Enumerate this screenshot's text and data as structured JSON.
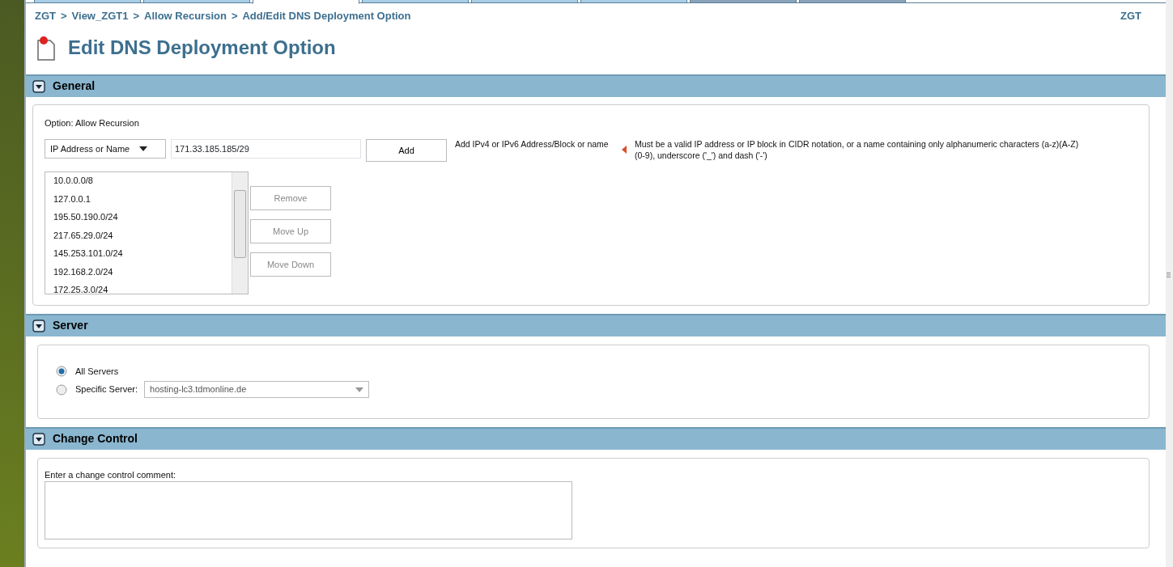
{
  "top_tabs": [
    {
      "selected": false,
      "color": "#a9cfe8"
    },
    {
      "selected": false,
      "color": "#a9cfe8"
    },
    {
      "selected": true,
      "color": "#ffffff"
    },
    {
      "selected": false,
      "color": "#a9cfe8"
    },
    {
      "selected": false,
      "color": "#a9cfe8"
    },
    {
      "selected": false,
      "color": "#a9cfe8"
    },
    {
      "selected": false,
      "color": "#8aa3b8"
    },
    {
      "selected": false,
      "color": "#8aa3b8"
    }
  ],
  "breadcrumb": {
    "items": [
      "ZGT",
      "View_ZGT1",
      "Allow Recursion",
      "Add/Edit DNS Deployment Option"
    ],
    "separator": ">",
    "user": "ZGT"
  },
  "page_title": "Edit DNS Deployment Option",
  "sections": [
    {
      "kind": "general",
      "title": "General",
      "expanded": true,
      "option_label": "Option: Allow Recursion",
      "type_select": "IP Address or Name",
      "address_value": "171.33.185.185/29",
      "add_button": "Add",
      "add_hint": "Add IPv4 or IPv6 Address/Block or name",
      "error": "Must be a valid IP address or IP block in CIDR notation, or a name containing only alphanumeric characters (a-z)(A-Z)(0-9), underscore ('_') and dash ('-')",
      "addresses": [
        "10.0.0.0/8",
        "127.0.0.1",
        "195.50.190.0/24",
        "217.65.29.0/24",
        "145.253.101.0/24",
        "192.168.2.0/24",
        "172.25.3.0/24"
      ],
      "list_buttons": [
        {
          "label": "Remove",
          "disabled": true
        },
        {
          "label": "Move Up",
          "disabled": true
        },
        {
          "label": "Move Down",
          "disabled": true
        }
      ]
    },
    {
      "kind": "server",
      "title": "Server",
      "expanded": true,
      "options": [
        {
          "label": "All Servers",
          "selected": true
        },
        {
          "label": "Specific Server:",
          "selected": false,
          "select_value": "hosting-lc3.tdmonline.de"
        }
      ]
    },
    {
      "kind": "change",
      "title": "Change Control",
      "expanded": true,
      "comment_label": "Enter a change control comment:"
    }
  ]
}
